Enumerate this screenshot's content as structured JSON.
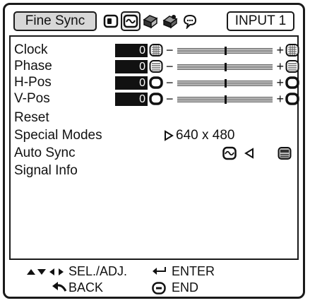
{
  "tabs": {
    "active_label": "Fine Sync",
    "icons": [
      "picture-adjust-icon",
      "fine-sync-icon",
      "audio-icon",
      "options-icon",
      "language-icon"
    ],
    "input_label": "INPUT 1"
  },
  "rows": [
    {
      "label": "Clock",
      "value": "0",
      "icon": "grille-icon",
      "min_icon": "−",
      "max_icon": "+",
      "level_percent": 50
    },
    {
      "label": "Phase",
      "value": "0",
      "icon": "grille-icon",
      "min_icon": "−",
      "max_icon": "+",
      "level_percent": 50
    },
    {
      "label": "H-Pos",
      "value": "0",
      "icon": "ring-icon",
      "min_icon": "−",
      "max_icon": "+",
      "level_percent": 50
    },
    {
      "label": "V-Pos",
      "value": "0",
      "icon": "ring-icon",
      "min_icon": "−",
      "max_icon": "+",
      "level_percent": 50
    }
  ],
  "items": {
    "reset": "Reset",
    "special_modes": "Special Modes",
    "special_modes_value": "640 x 480",
    "auto_sync": "Auto Sync",
    "signal_info": "Signal Info"
  },
  "footer": {
    "sel_adj": "SEL./ADJ.",
    "enter": "ENTER",
    "back": "BACK",
    "end": "END"
  },
  "colors": {
    "text": "#111111",
    "tab_active_bg": "#d7d7d7",
    "value_box_bg": "#111111"
  }
}
